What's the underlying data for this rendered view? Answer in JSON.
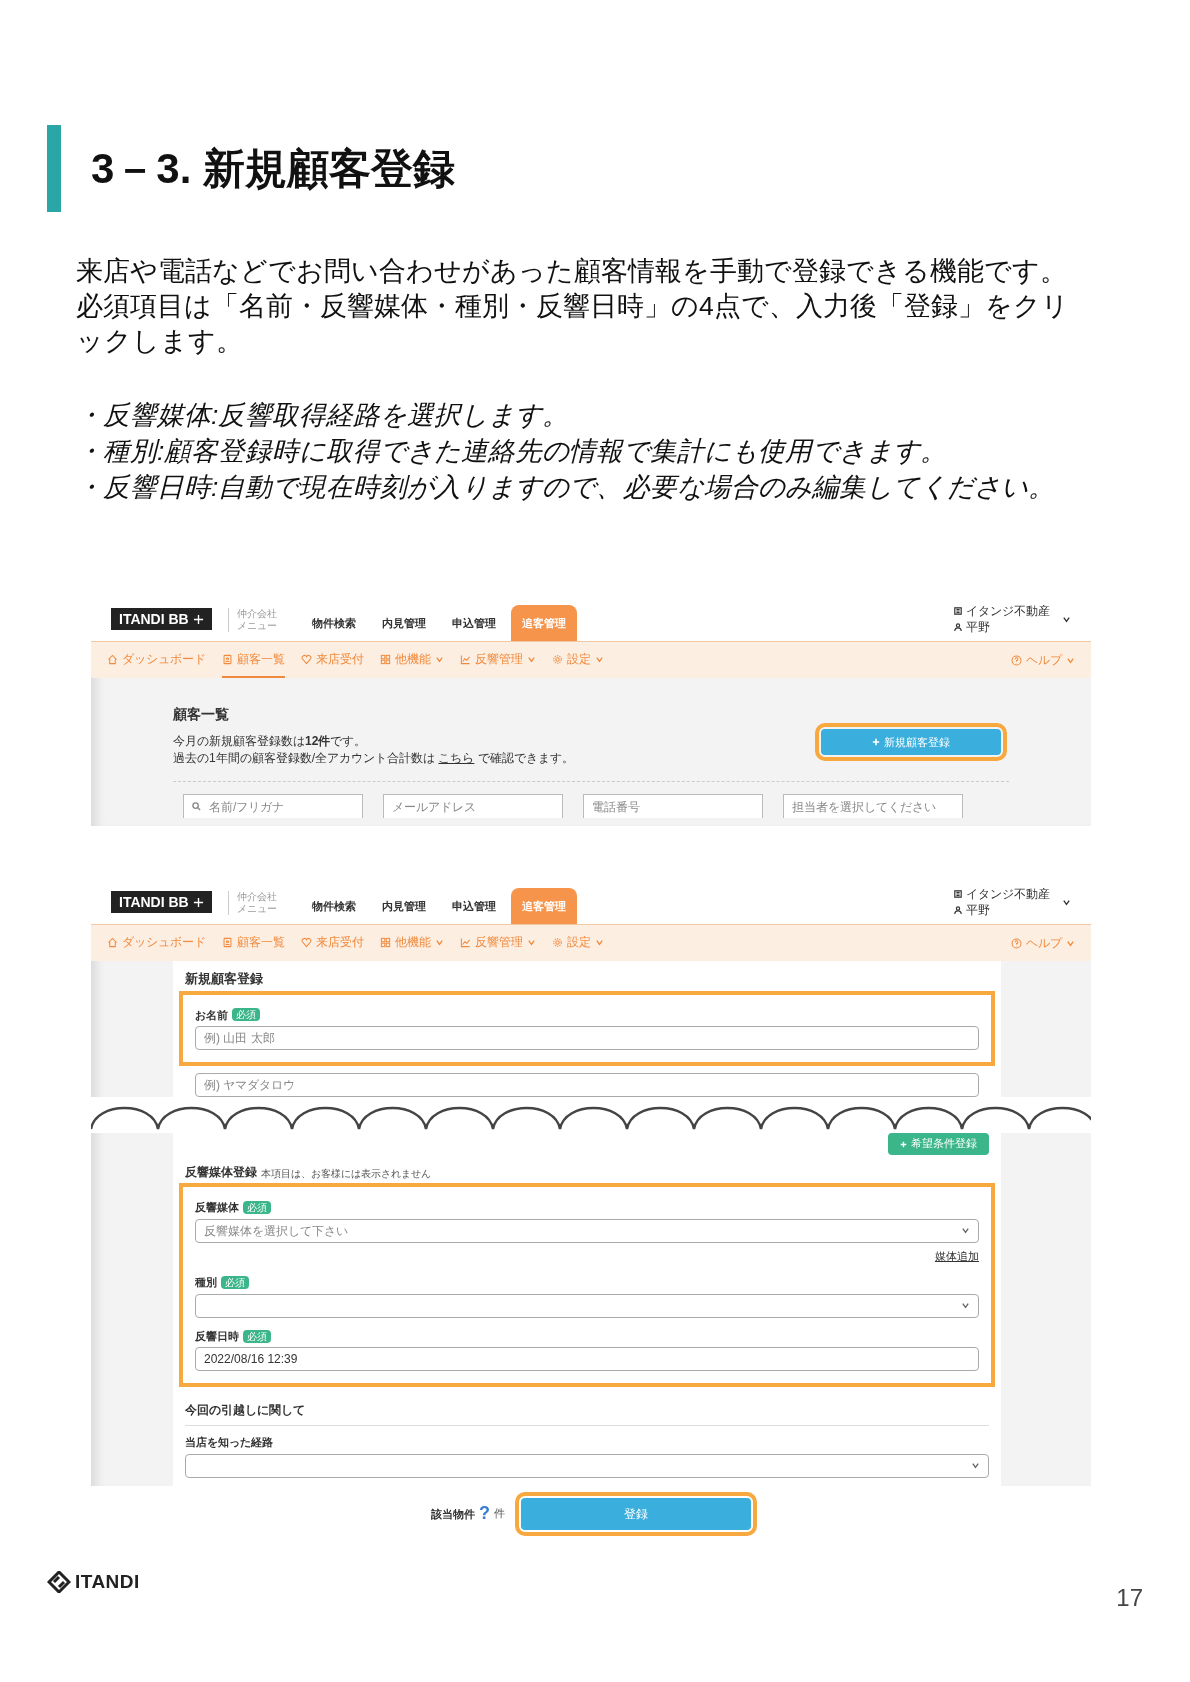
{
  "heading": "3－3. 新規顧客登録",
  "intro": "来店や電話などでお問い合わせがあった顧客情報を手動で登録できる機能です。必須項目は「名前・反響媒体・種別・反響日時」の4点で、入力後「登録」をクリックします。",
  "bullets": [
    "・反響媒体:反響取得経路を選択します。",
    "・種別:顧客登録時に取得できた連絡先の情報で集計にも使用できます。",
    "・反響日時:自動で現在時刻が入りますので、必要な場合のみ編集してください。"
  ],
  "screenshot_list": {
    "header": {
      "logo": "ITANDI BB",
      "menu_label": [
        "仲介会社",
        "メニュー"
      ],
      "tabs": [
        {
          "label": "物件検索",
          "selected": false
        },
        {
          "label": "内見管理",
          "selected": false
        },
        {
          "label": "申込管理",
          "selected": false
        },
        {
          "label": "追客管理",
          "selected": true
        }
      ],
      "company": "イタンジ不動産",
      "user": "平野",
      "subnav": [
        {
          "label": "ダッシュボード",
          "selected": false,
          "dropdown": false
        },
        {
          "label": "顧客一覧",
          "selected": true,
          "dropdown": false
        },
        {
          "label": "来店受付",
          "selected": false,
          "dropdown": false
        },
        {
          "label": "他機能",
          "selected": false,
          "dropdown": true
        },
        {
          "label": "反響管理",
          "selected": false,
          "dropdown": true
        },
        {
          "label": "設定",
          "selected": false,
          "dropdown": true
        }
      ],
      "help": "ヘルプ"
    },
    "title": "顧客一覧",
    "notice": "今月の新規顧客登録数は**12件**です。",
    "notice_2": {
      "before": "過去の1年間の顧客登録数/全アカウント合計数は",
      "link": "こちら",
      "after": "で確認できます。"
    },
    "new_button": {
      "label": "新規顧客登録",
      "highlighted": true
    },
    "filters": [
      {
        "kind": "search",
        "placeholder": "名前/フリガナ"
      },
      {
        "kind": "text",
        "placeholder": "メールアドレス"
      },
      {
        "kind": "text",
        "placeholder": "電話番号"
      },
      {
        "kind": "text",
        "placeholder": "担当者を選択してください"
      }
    ]
  },
  "screenshot_form": {
    "header": {
      "logo": "ITANDI BB",
      "menu_label": [
        "仲介会社",
        "メニュー"
      ],
      "tabs": [
        {
          "label": "物件検索",
          "selected": false
        },
        {
          "label": "内見管理",
          "selected": false
        },
        {
          "label": "申込管理",
          "selected": false
        },
        {
          "label": "追客管理",
          "selected": true
        }
      ],
      "company": "イタンジ不動産",
      "user": "平野",
      "subnav": [
        {
          "label": "ダッシュボード",
          "selected": false,
          "dropdown": false
        },
        {
          "label": "顧客一覧",
          "selected": false,
          "dropdown": false
        },
        {
          "label": "来店受付",
          "selected": false,
          "dropdown": false
        },
        {
          "label": "他機能",
          "selected": false,
          "dropdown": true
        },
        {
          "label": "反響管理",
          "selected": false,
          "dropdown": true
        },
        {
          "label": "設定",
          "selected": false,
          "dropdown": true
        }
      ],
      "help": "ヘルプ"
    },
    "title": "新規顧客登録",
    "name_field": {
      "label": "お名前",
      "badge": "必須",
      "placeholder": "例) 山田 太郎",
      "highlighted": true
    },
    "furigana_field": {
      "placeholder": "例) ヤマダタロウ"
    },
    "condition_button": "希望条件登録",
    "media_section": {
      "title": "反響媒体登録",
      "note": "本項目は、お客様には表示されません",
      "highlighted": true,
      "fields": [
        {
          "kind": "select",
          "label": "反響媒体",
          "badge": "必須",
          "placeholder": "反響媒体を選択して下さい",
          "link": "媒体追加"
        },
        {
          "kind": "select",
          "label": "種別",
          "badge": "必須"
        },
        {
          "kind": "text",
          "label": "反響日時",
          "badge": "必須",
          "value": "2022/08/16 12:39"
        }
      ]
    },
    "move_section": {
      "title": "今回の引越しに関して",
      "fields": [
        {
          "kind": "select",
          "label": "当店を知った経路"
        }
      ]
    },
    "footer": {
      "label": "該当物件",
      "count": "?",
      "unit": "件",
      "button": "登録",
      "highlighted": true
    }
  },
  "logo": "ITANDI",
  "page_number": "17"
}
